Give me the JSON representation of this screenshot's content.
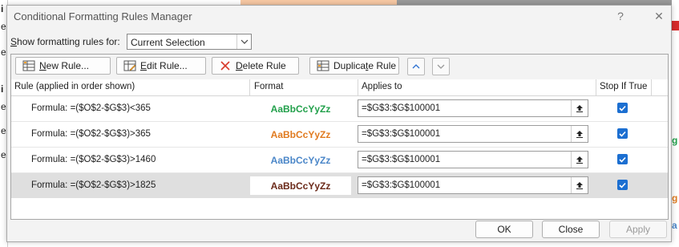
{
  "dialog": {
    "title": "Conditional Formatting Rules Manager",
    "help_label": "?",
    "close_label": "✕"
  },
  "show_rules": {
    "label_prefix": "S",
    "label_rest": "how formatting rules for:",
    "selected": "Current Selection"
  },
  "toolbar": {
    "new_rule": {
      "mnemonic": "N",
      "rest": "ew Rule..."
    },
    "edit_rule": {
      "mnemonic": "E",
      "rest": "dit Rule..."
    },
    "delete_rule": {
      "mnemonic": "D",
      "rest": "elete Rule"
    },
    "duplicate_rule": {
      "pre": "Duplica",
      "mnemonic": "t",
      "rest": "e Rule"
    }
  },
  "columns": {
    "rule": "Rule (applied in order shown)",
    "format": "Format",
    "applies_to": "Applies to",
    "stop_if_true": "Stop If True"
  },
  "rules": [
    {
      "rule": "Formula: =($O$2-$G$3)<365",
      "preview": "AaBbCcYyZz",
      "color": "#22a04b",
      "applies_to": "=$G$3:$G$100001",
      "stop_if_true": true
    },
    {
      "rule": "Formula: =($O$2-$G$3)>365",
      "preview": "AaBbCcYyZz",
      "color": "#e07a1f",
      "applies_to": "=$G$3:$G$100001",
      "stop_if_true": true
    },
    {
      "rule": "Formula: =($O$2-$G$3)>1460",
      "preview": "AaBbCcYyZz",
      "color": "#4a86c8",
      "applies_to": "=$G$3:$G$100001",
      "stop_if_true": true
    },
    {
      "rule": "Formula: =($O$2-$G$3)>1825",
      "preview": "AaBbCcYyZz",
      "color": "#6b2a1a",
      "applies_to": "=$G$3:$G$100001",
      "stop_if_true": true
    }
  ],
  "buttons": {
    "ok": "OK",
    "close": "Close",
    "apply": "Apply"
  },
  "background_fragments": {
    "left": [
      "i",
      "e",
      "e",
      "i",
      "e",
      "e",
      "e"
    ],
    "right": [
      "g",
      "g",
      "a",
      "g"
    ]
  }
}
